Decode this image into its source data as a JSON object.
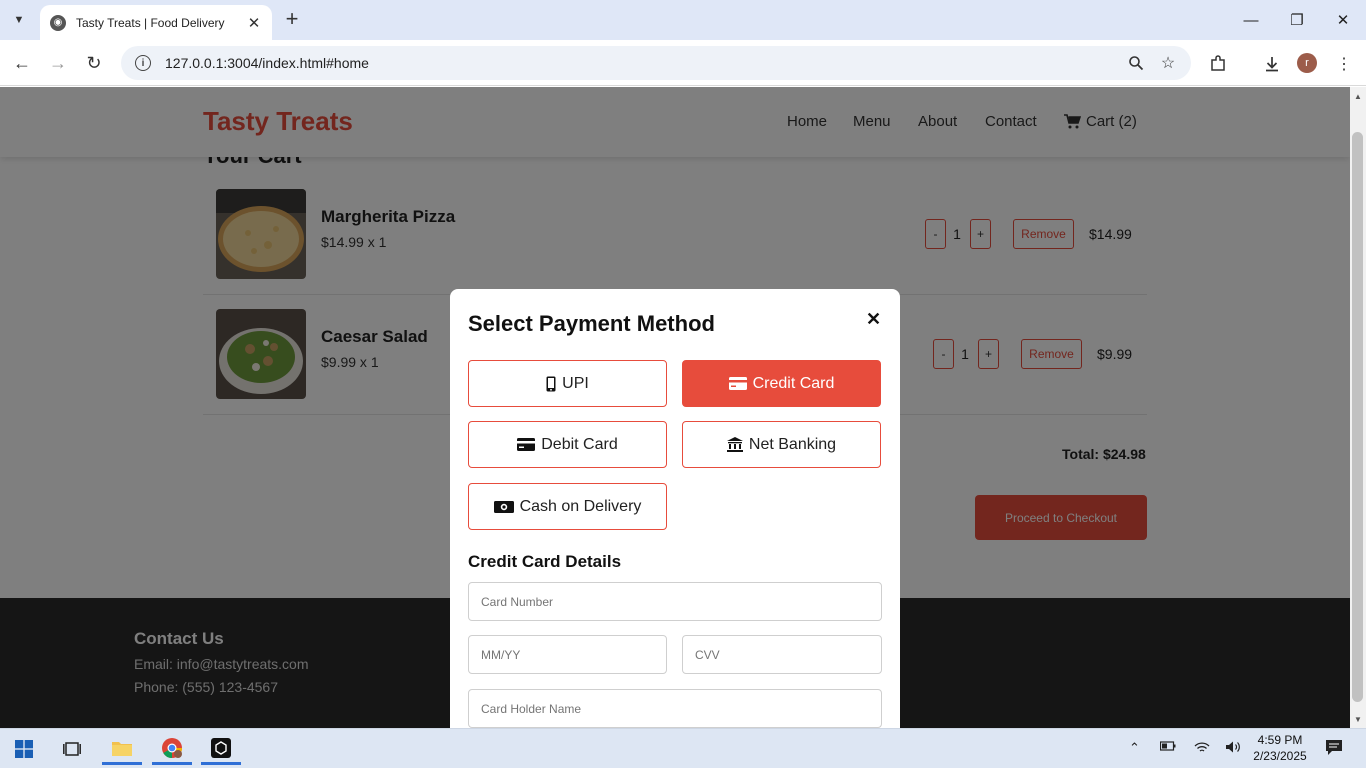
{
  "browser": {
    "tab_title": "Tasty Treats | Food Delivery",
    "url": "127.0.0.1:3004/index.html#home",
    "profile_initial": "r"
  },
  "site": {
    "logo": "Tasty Treats",
    "nav": [
      "Home",
      "Menu",
      "About",
      "Contact"
    ],
    "cart_label": "Cart (2)",
    "brand_color": "#e74c3c"
  },
  "cart": {
    "title": "Your Cart",
    "items": [
      {
        "name": "Margherita Pizza",
        "price_line": "$14.99 x 1",
        "qty": "1",
        "remove": "Remove",
        "total": "$14.99"
      },
      {
        "name": "Caesar Salad",
        "price_line": "$9.99 x 1",
        "qty": "1",
        "remove": "Remove",
        "total": "$9.99"
      }
    ],
    "minus": "-",
    "plus": "+",
    "total": "Total: $24.98",
    "checkout": "Proceed to Checkout"
  },
  "footer": {
    "heading": "Contact Us",
    "email": "Email: info@tastytreats.com",
    "phone": "Phone: (555) 123-4567"
  },
  "modal": {
    "title": "Select Payment Method",
    "close": "✕",
    "methods": [
      {
        "label": "UPI",
        "icon": "mobile-icon"
      },
      {
        "label": "Credit Card",
        "icon": "credit-card-icon",
        "selected": true
      },
      {
        "label": "Debit Card",
        "icon": "debit-card-icon"
      },
      {
        "label": "Net Banking",
        "icon": "bank-icon"
      },
      {
        "label": "Cash on Delivery",
        "icon": "cash-icon"
      }
    ],
    "details_title": "Credit Card Details",
    "fields": {
      "card_number": "Card Number",
      "expiry": "MM/YY",
      "cvv": "CVV",
      "holder": "Card Holder Name"
    }
  },
  "taskbar": {
    "time": "4:59 PM",
    "date": "2/23/2025"
  }
}
